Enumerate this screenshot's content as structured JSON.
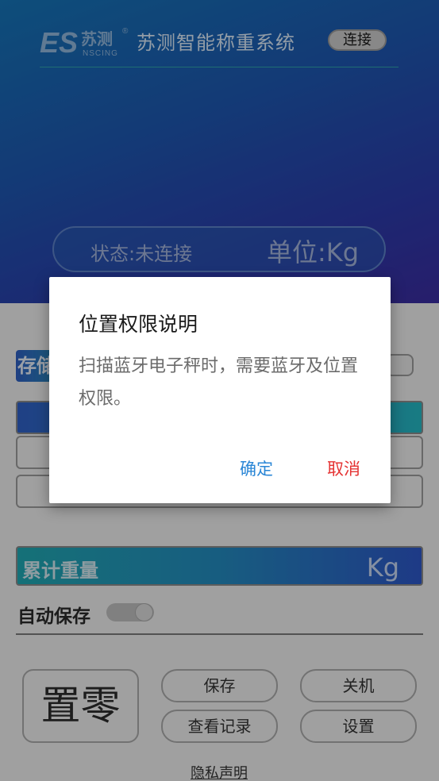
{
  "header": {
    "logo_text": "ES苏测",
    "logo_sub": "NSCING",
    "logo_reg": "®",
    "title": "苏测智能称重系统",
    "connect_label": "连接"
  },
  "status": {
    "state_text": "状态:未连接",
    "unit_text": "单位:Kg"
  },
  "storage": {
    "label": "存储"
  },
  "total": {
    "label": "累计重量",
    "unit": "Kg"
  },
  "autosave": {
    "label": "自动保存",
    "enabled": false
  },
  "buttons": {
    "zero": "置零",
    "save": "保存",
    "shutdown": "关机",
    "records": "查看记录",
    "settings": "设置"
  },
  "footer": {
    "privacy": "隐私声明"
  },
  "dialog": {
    "title": "位置权限说明",
    "message": "扫描蓝牙电子秤时，需要蓝牙及位置权限。",
    "confirm": "确定",
    "cancel": "取消"
  },
  "colors": {
    "confirm": "#2a86d6",
    "cancel": "#e53333"
  }
}
